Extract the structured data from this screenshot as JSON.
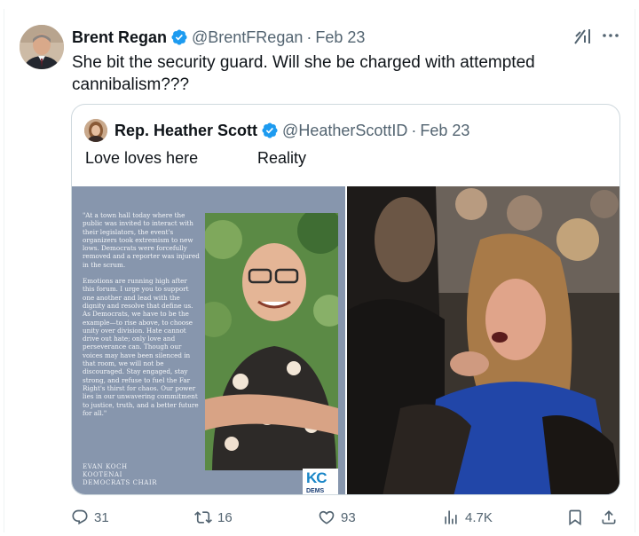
{
  "tweet": {
    "author_name": "Brent Regan",
    "author_handle": "@BrentFRegan",
    "separator": "·",
    "date": "Feb 23",
    "text": "She bit the security guard. Will she be charged with attempted cannibalism???"
  },
  "quoted_tweet": {
    "author_name": "Rep. Heather Scott",
    "author_handle": "@HeatherScottID",
    "separator": "·",
    "date": "Feb 23",
    "text_left": "Love loves here",
    "text_right": "Reality",
    "media_left": {
      "statement_paragraphs": [
        "\"At a town hall today where the public was invited to interact with their legislators, the event's organizers took extremism to new lows. Democrats were forcefully removed and a reporter was injured in the scrum.",
        "Emotions are running high after this forum. I urge you to support one another and lead with the dignity and resolve that define us. As Democrats, we have to be the example—to rise above, to choose unity over division. Hate cannot drive out hate; only love and perseverance can. Though our voices may have been silenced in that room, we will not be discouraged. Stay engaged, stay strong, and refuse to fuel the Far Right's thirst for chaos. Our power lies in our unwavering commitment to justice, truth, and a better future for all.\""
      ],
      "signature_lines": [
        "EVAN KOCH",
        "KOOTENAI",
        "DEMOCRATS CHAIR"
      ],
      "logo_text": "KC",
      "logo_subtext": "DEMS"
    }
  },
  "actions": {
    "reply_count": "31",
    "retweet_count": "16",
    "like_count": "93",
    "view_count": "4.7K"
  },
  "icons": [
    "verified-badge-icon",
    "grok-icon",
    "more-icon",
    "reply-icon",
    "retweet-icon",
    "like-icon",
    "views-icon",
    "bookmark-icon",
    "share-icon"
  ],
  "colors": {
    "verified": "#1d9bf0",
    "text": "#0f1419",
    "secondary": "#536471",
    "border": "#cfd9de"
  }
}
